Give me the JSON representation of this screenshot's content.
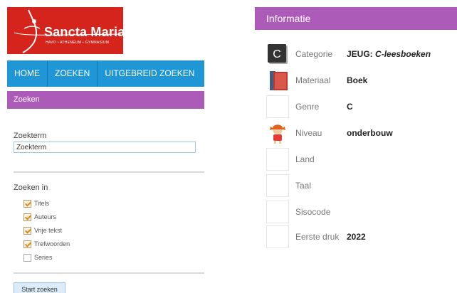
{
  "logo": {
    "title": "Sancta Maria",
    "subtitle": "HAVO • ATHENEUM • GYMNASIUM"
  },
  "nav": {
    "items": [
      "HOME",
      "ZOEKEN",
      "UITGEBREID ZOEKEN"
    ]
  },
  "search_panel": {
    "header": "Zoeken",
    "term_label": "Zoekterm",
    "term_value": "Zoekterm",
    "scope_label": "Zoeken in",
    "options": [
      {
        "label": "Titels",
        "checked": true
      },
      {
        "label": "Auteurs",
        "checked": true
      },
      {
        "label": "Vrije tekst",
        "checked": true
      },
      {
        "label": "Trefwoorden",
        "checked": true
      },
      {
        "label": "Series",
        "checked": false
      }
    ],
    "submit_label": "Start zoeken"
  },
  "info": {
    "header": "Informatie",
    "rows": [
      {
        "key": "Categorie",
        "value": "JEUG:",
        "value_italic": "C-leesboeken",
        "icon": "category-c-icon"
      },
      {
        "key": "Materiaal",
        "value": "Boek",
        "icon": "book-icon"
      },
      {
        "key": "Genre",
        "value": "C",
        "icon": "blank-icon"
      },
      {
        "key": "Niveau",
        "value": "onderbouw",
        "icon": "child-icon"
      },
      {
        "key": "Land",
        "value": "",
        "icon": "blank-icon"
      },
      {
        "key": "Taal",
        "value": "",
        "icon": "blank-icon"
      },
      {
        "key": "Sisocode",
        "value": "",
        "icon": "blank-icon"
      },
      {
        "key": "Eerste druk",
        "value": "2022",
        "icon": "blank-icon"
      }
    ]
  },
  "colors": {
    "logo_red": "#d4241c",
    "nav_blue": "#1f97d6",
    "purple": "#ad5bb9",
    "check_orange": "#e08a1a"
  }
}
